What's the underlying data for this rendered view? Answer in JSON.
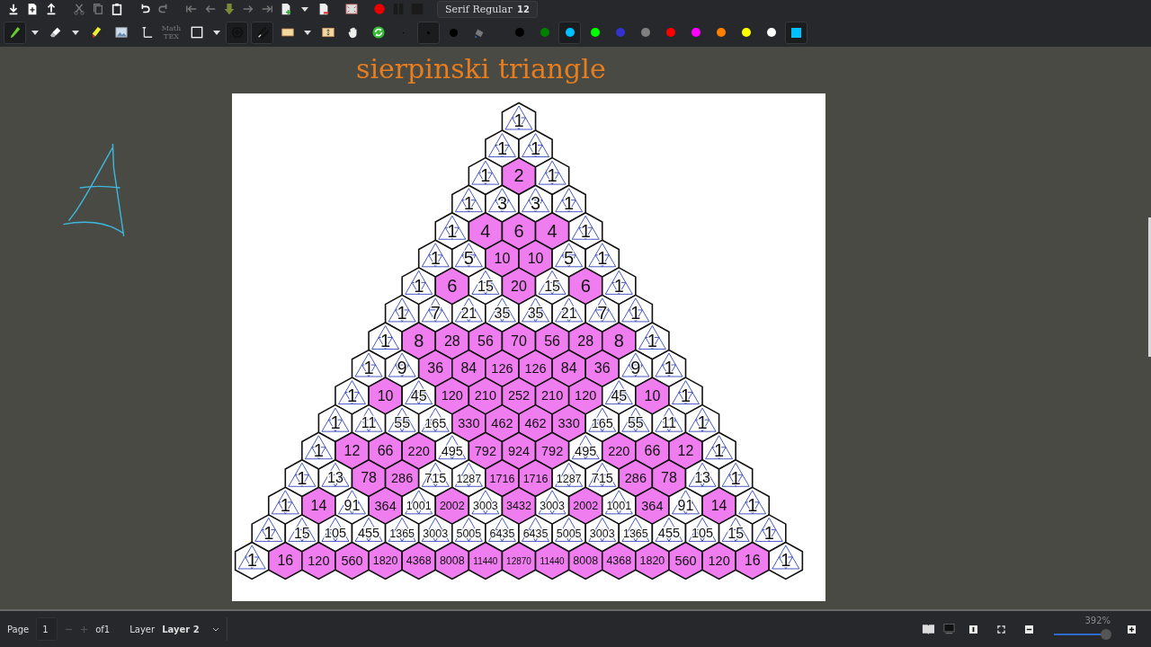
{
  "toolbar": {
    "font": {
      "name": "Serif Regular",
      "size": "12"
    },
    "tools": [
      {
        "kind": "pen",
        "selected": true
      },
      {
        "kind": "caret",
        "selected": false
      },
      {
        "kind": "eraser",
        "selected": false
      },
      {
        "kind": "caret",
        "selected": false
      },
      {
        "kind": "highlighter",
        "selected": false
      },
      {
        "kind": "image",
        "selected": false
      },
      {
        "kind": "text",
        "selected": false
      },
      {
        "kind": "tex",
        "label": "Math TEX",
        "selected": false
      },
      {
        "kind": "rectangle",
        "selected": false
      },
      {
        "kind": "caret",
        "selected": false
      },
      {
        "kind": "rotation-snap",
        "selected": true
      },
      {
        "kind": "grid-snap",
        "selected": true
      },
      {
        "kind": "select",
        "selected": false
      },
      {
        "kind": "caret",
        "selected": false
      },
      {
        "kind": "vertical-space",
        "selected": false
      },
      {
        "kind": "hand",
        "selected": false
      },
      {
        "kind": "refresh",
        "selected": false
      },
      {
        "kind": "dot-fine",
        "selected": false
      },
      {
        "kind": "dot-medium",
        "selected": true
      },
      {
        "kind": "dot-thick",
        "selected": false
      },
      {
        "kind": "fill",
        "selected": false
      }
    ],
    "colors": [
      {
        "color": "#000000",
        "selected": false
      },
      {
        "color": "#008000",
        "selected": false
      },
      {
        "color": "#00c0ff",
        "selected": true
      },
      {
        "color": "#00ff00",
        "selected": false
      },
      {
        "color": "#3333cc",
        "selected": false
      },
      {
        "color": "#808080",
        "selected": false
      },
      {
        "color": "#ff0000",
        "selected": false
      },
      {
        "color": "#ff00ff",
        "selected": false
      },
      {
        "color": "#ff8000",
        "selected": false
      },
      {
        "color": "#ffff00",
        "selected": false
      },
      {
        "color": "#ffffff",
        "selected": false
      }
    ],
    "custom_color": {
      "color": "#00c0ff",
      "selected": true
    }
  },
  "page": {
    "title": "sierpinski triangle",
    "figure": {
      "rows": [
        {
          "values": [
            "1"
          ],
          "shaded": [
            false
          ]
        },
        {
          "values": [
            "1",
            "1"
          ],
          "shaded": [
            false,
            false
          ]
        },
        {
          "values": [
            "1",
            "2",
            "1"
          ],
          "shaded": [
            false,
            true,
            false
          ]
        },
        {
          "values": [
            "1",
            "3",
            "3",
            "1"
          ],
          "shaded": [
            false,
            false,
            false,
            false
          ]
        },
        {
          "values": [
            "1",
            "4",
            "6",
            "4",
            "1"
          ],
          "shaded": [
            false,
            true,
            true,
            true,
            false
          ]
        },
        {
          "values": [
            "1",
            "5",
            "10",
            "10",
            "5",
            "1"
          ],
          "shaded": [
            false,
            false,
            true,
            true,
            false,
            false
          ]
        },
        {
          "values": [
            "1",
            "6",
            "15",
            "20",
            "15",
            "6",
            "1"
          ],
          "shaded": [
            false,
            true,
            false,
            true,
            false,
            true,
            false
          ]
        },
        {
          "values": [
            "1",
            "7",
            "21",
            "35",
            "35",
            "21",
            "7",
            "1"
          ],
          "shaded": [
            false,
            false,
            false,
            false,
            false,
            false,
            false,
            false
          ]
        },
        {
          "values": [
            "1",
            "8",
            "28",
            "56",
            "70",
            "56",
            "28",
            "8",
            "1"
          ],
          "shaded": [
            false,
            true,
            true,
            true,
            true,
            true,
            true,
            true,
            false
          ]
        },
        {
          "values": [
            "1",
            "9",
            "36",
            "84",
            "126",
            "126",
            "84",
            "36",
            "9",
            "1"
          ],
          "shaded": [
            false,
            false,
            true,
            true,
            true,
            true,
            true,
            true,
            false,
            false
          ]
        },
        {
          "values": [
            "1",
            "10",
            "45",
            "120",
            "210",
            "252",
            "210",
            "120",
            "45",
            "10",
            "1"
          ],
          "shaded": [
            false,
            true,
            false,
            true,
            true,
            true,
            true,
            true,
            false,
            true,
            false
          ]
        },
        {
          "values": [
            "1",
            "11",
            "55",
            "165",
            "330",
            "462",
            "462",
            "330",
            "165",
            "55",
            "11",
            "1"
          ],
          "shaded": [
            false,
            false,
            false,
            false,
            true,
            true,
            true,
            true,
            false,
            false,
            false,
            false
          ]
        },
        {
          "values": [
            "1",
            "12",
            "66",
            "220",
            "495",
            "792",
            "924",
            "792",
            "495",
            "220",
            "66",
            "12",
            "1"
          ],
          "shaded": [
            false,
            true,
            true,
            true,
            false,
            true,
            true,
            true,
            false,
            true,
            true,
            true,
            false
          ]
        },
        {
          "values": [
            "1",
            "13",
            "78",
            "286",
            "715",
            "1287",
            "1716",
            "1716",
            "1287",
            "715",
            "286",
            "78",
            "13",
            "1"
          ],
          "shaded": [
            false,
            false,
            true,
            true,
            false,
            false,
            true,
            true,
            false,
            false,
            true,
            true,
            false,
            false
          ]
        },
        {
          "values": [
            "1",
            "14",
            "91",
            "364",
            "1001",
            "2002",
            "3003",
            "3432",
            "3003",
            "2002",
            "1001",
            "364",
            "91",
            "14",
            "1"
          ],
          "shaded": [
            false,
            true,
            false,
            true,
            false,
            true,
            false,
            true,
            false,
            true,
            false,
            true,
            false,
            true,
            false
          ]
        },
        {
          "values": [
            "1",
            "15",
            "105",
            "455",
            "1365",
            "3003",
            "5005",
            "6435",
            "6435",
            "5005",
            "3003",
            "1365",
            "455",
            "105",
            "15",
            "1"
          ],
          "shaded": [
            false,
            false,
            false,
            false,
            false,
            false,
            false,
            false,
            false,
            false,
            false,
            false,
            false,
            false,
            false,
            false
          ]
        },
        {
          "values": [
            "1",
            "16",
            "120",
            "560",
            "1820",
            "4368",
            "8008",
            "11440",
            "12870",
            "11440",
            "8008",
            "4368",
            "1820",
            "560",
            "120",
            "16",
            "1"
          ],
          "shaded": [
            false,
            true,
            true,
            true,
            true,
            true,
            true,
            true,
            true,
            true,
            true,
            true,
            true,
            true,
            true,
            true,
            false
          ]
        }
      ]
    }
  },
  "status_bar": {
    "page_label": "Page",
    "page": "1",
    "page_count": "of1",
    "layer_label": "Layer",
    "layer": "Layer 2",
    "zoom": "392%",
    "zoom_slider": {
      "level": 0.9
    }
  }
}
